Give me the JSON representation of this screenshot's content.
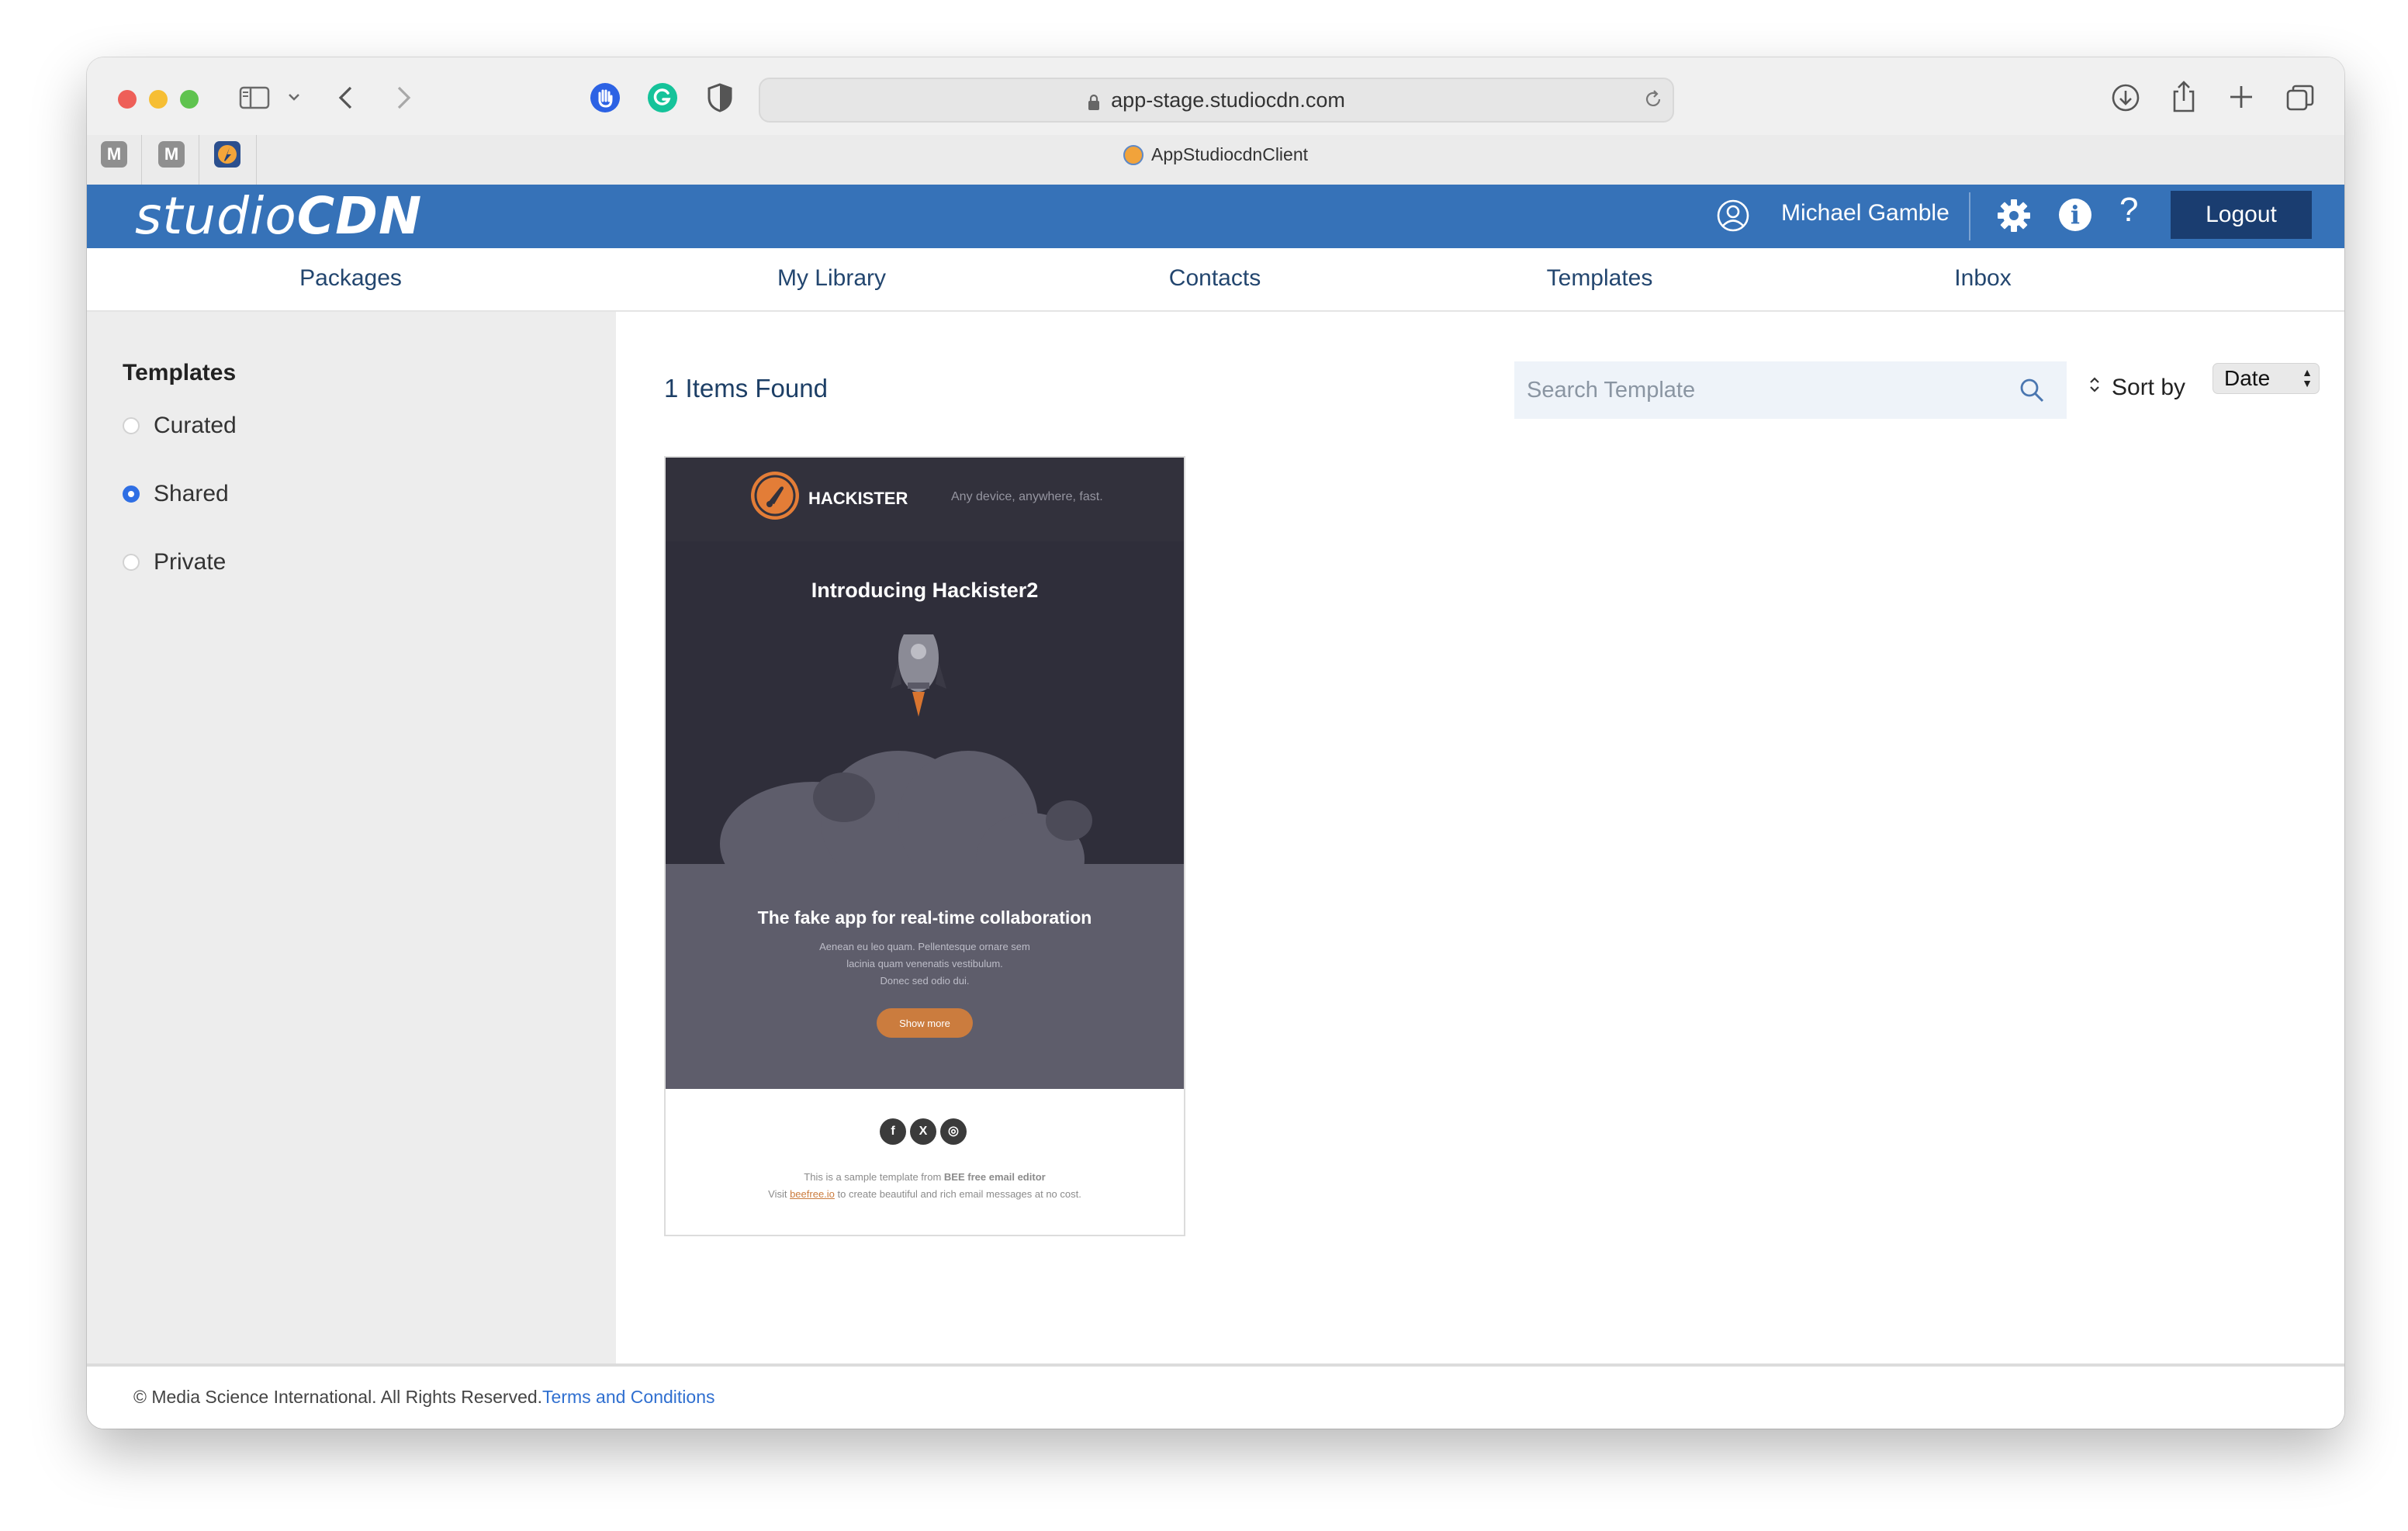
{
  "browser": {
    "url": "app-stage.studiocdn.com",
    "tab_title": "AppStudiocdnClient",
    "pinned_tabs": [
      "M",
      "M"
    ]
  },
  "header": {
    "logo_thin": "studio",
    "logo_bold": "CDN",
    "username": "Michael Gamble",
    "logout_label": "Logout",
    "help_glyph": "?",
    "info_glyph": "i"
  },
  "nav": {
    "items": [
      "Packages",
      "My Library",
      "Contacts",
      "Templates",
      "Inbox"
    ]
  },
  "sidebar": {
    "title": "Templates",
    "options": [
      {
        "label": "Curated",
        "checked": false
      },
      {
        "label": "Shared",
        "checked": true
      },
      {
        "label": "Private",
        "checked": false
      }
    ]
  },
  "main": {
    "items_found": "1 Items Found",
    "search_placeholder": "Search Template",
    "sort_label": "Sort by",
    "sort_value": "Date"
  },
  "template": {
    "brand": "HACKISTER",
    "tagline": "Any device, anywhere, fast.",
    "hero_title": "Introducing Hackister2",
    "lower_title": "The fake app for real-time collaboration",
    "body_lines": [
      "Aenean eu leo quam. Pellentesque ornare sem",
      "lacinia quam venenatis vestibulum.",
      "Donec sed odio dui."
    ],
    "button_label": "Show more",
    "social_glyphs": [
      "f",
      "X",
      "◎"
    ],
    "footer_line1_prefix": "This is a sample template from ",
    "footer_line1_bold": "BEE free email editor",
    "footer_line2_prefix": "Visit ",
    "footer_line2_link": "beefree.io",
    "footer_line2_suffix": " to create beautiful and rich email messages at no cost."
  },
  "footer": {
    "copyright": "© Media Science International. All Rights Reserved.",
    "terms_link": "Terms and Conditions"
  },
  "colors": {
    "header_blue": "#3672b8",
    "logout_bg": "#1a3d70",
    "accent_orange": "#cb7c3e",
    "nav_text": "#23466f"
  }
}
